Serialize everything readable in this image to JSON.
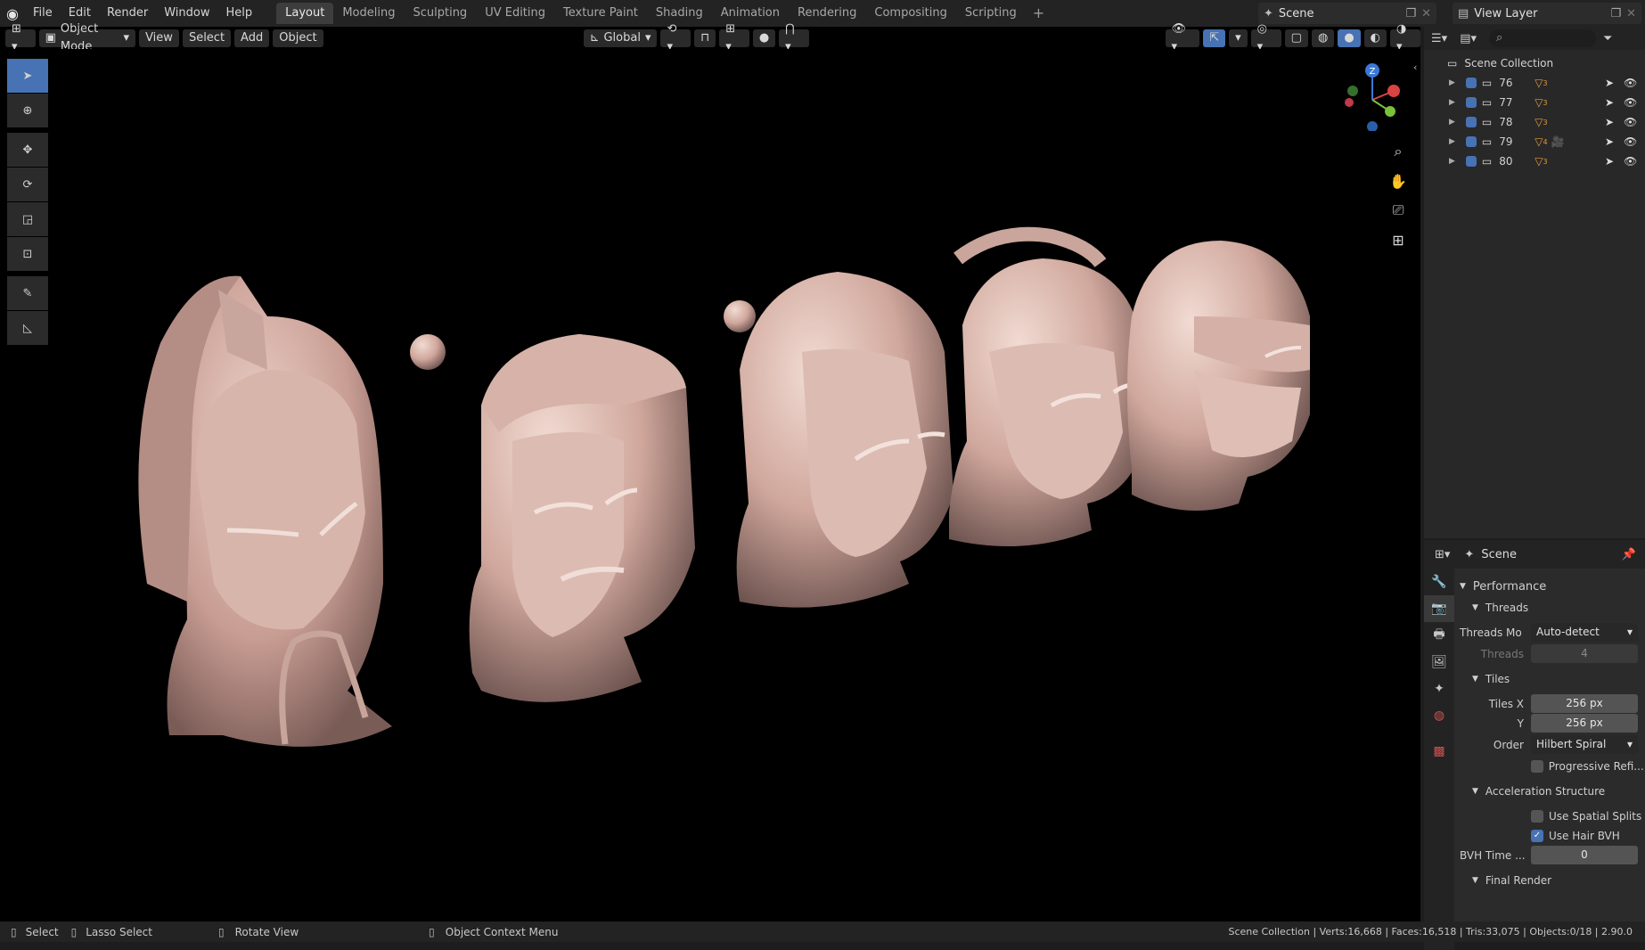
{
  "menus": [
    "File",
    "Edit",
    "Render",
    "Window",
    "Help"
  ],
  "workspaces": [
    "Layout",
    "Modeling",
    "Sculpting",
    "UV Editing",
    "Texture Paint",
    "Shading",
    "Animation",
    "Rendering",
    "Compositing",
    "Scripting"
  ],
  "active_workspace": "Layout",
  "scene_name": "Scene",
  "view_layer_name": "View Layer",
  "viewport_header": {
    "mode": "Object Mode",
    "menus": [
      "View",
      "Select",
      "Add",
      "Object"
    ],
    "orientation": "Global"
  },
  "gizmo": {
    "z": "Z"
  },
  "outliner": {
    "root": "Scene Collection",
    "collections": [
      {
        "name": "76",
        "count": "3"
      },
      {
        "name": "77",
        "count": "3"
      },
      {
        "name": "78",
        "count": "3"
      },
      {
        "name": "79",
        "count": "4"
      },
      {
        "name": "80",
        "count": "3"
      }
    ]
  },
  "properties": {
    "context": "Scene",
    "performance": "Performance",
    "threads_section": "Threads",
    "threads_mode_label": "Threads Mo",
    "threads_mode_value": "Auto-detect",
    "threads_label": "Threads",
    "threads_value": "4",
    "tiles_section": "Tiles",
    "tiles_x_label": "Tiles X",
    "tiles_x_value": "256 px",
    "tiles_y_label": "Y",
    "tiles_y_value": "256 px",
    "order_label": "Order",
    "order_value": "Hilbert Spiral",
    "progressive_label": "Progressive Refi...",
    "accel_section": "Acceleration Structure",
    "spatial_splits_label": "Use Spatial Splits",
    "hair_bvh_label": "Use Hair BVH",
    "bvh_time_label": "BVH Time ...",
    "bvh_time_value": "0",
    "final_render_section": "Final Render"
  },
  "status": {
    "select": "Select",
    "lasso": "Lasso Select",
    "rotate": "Rotate View",
    "context_menu": "Object Context Menu",
    "stats": "Scene Collection | Verts:16,668 | Faces:16,518 | Tris:33,075 | Objects:0/18 | 2.90.0"
  },
  "colors": {
    "accent": "#4772b3",
    "object_orange": "#e09a3e",
    "model_skin": "#d8b3a8"
  }
}
